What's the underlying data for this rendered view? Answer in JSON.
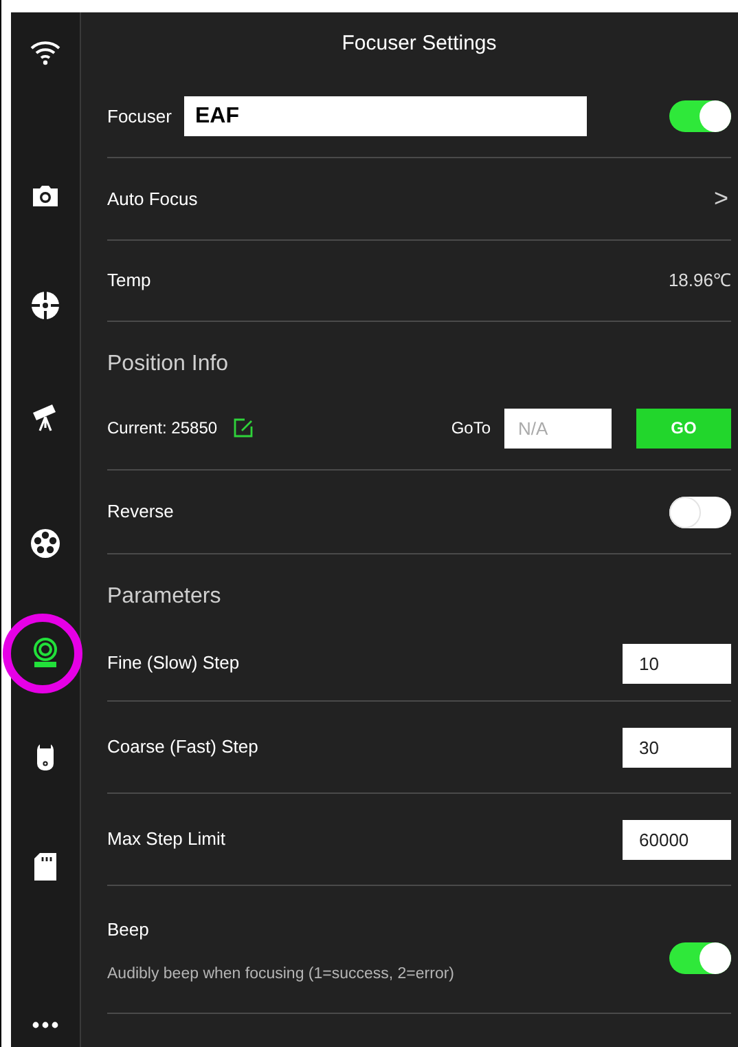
{
  "title": "Focuser Settings",
  "sidebar": {
    "items": [
      {
        "selected": false
      },
      {
        "selected": false
      },
      {
        "selected": false
      },
      {
        "selected": false
      },
      {
        "selected": false
      },
      {
        "selected": true
      },
      {
        "selected": false
      },
      {
        "selected": false
      },
      {
        "selected": false
      }
    ]
  },
  "rows": [
    {
      "kind": "device",
      "label": "Focuser",
      "value": "EAF",
      "on": true
    },
    {
      "kind": "link",
      "label": "Auto Focus",
      "chevron": ">"
    },
    {
      "kind": "value",
      "label": "Temp",
      "value": "18.96℃"
    },
    {
      "kind": "section",
      "label": "Position Info"
    },
    {
      "kind": "position",
      "label": "Current: 25850",
      "goto_label": "GoTo",
      "placeholder": "N/A",
      "button": "GO"
    },
    {
      "kind": "toggle",
      "label": "Reverse",
      "on": false
    },
    {
      "kind": "section",
      "label": "Parameters"
    },
    {
      "kind": "number",
      "label": "Fine (Slow) Step",
      "value": "10"
    },
    {
      "kind": "number",
      "label": "Coarse (Fast) Step",
      "value": "30"
    },
    {
      "kind": "number",
      "label": "Max Step Limit",
      "value": "60000"
    },
    {
      "kind": "toggle",
      "label": "Beep",
      "on": true,
      "description": "Audibly beep when focusing (1=success, 2=error)"
    }
  ]
}
